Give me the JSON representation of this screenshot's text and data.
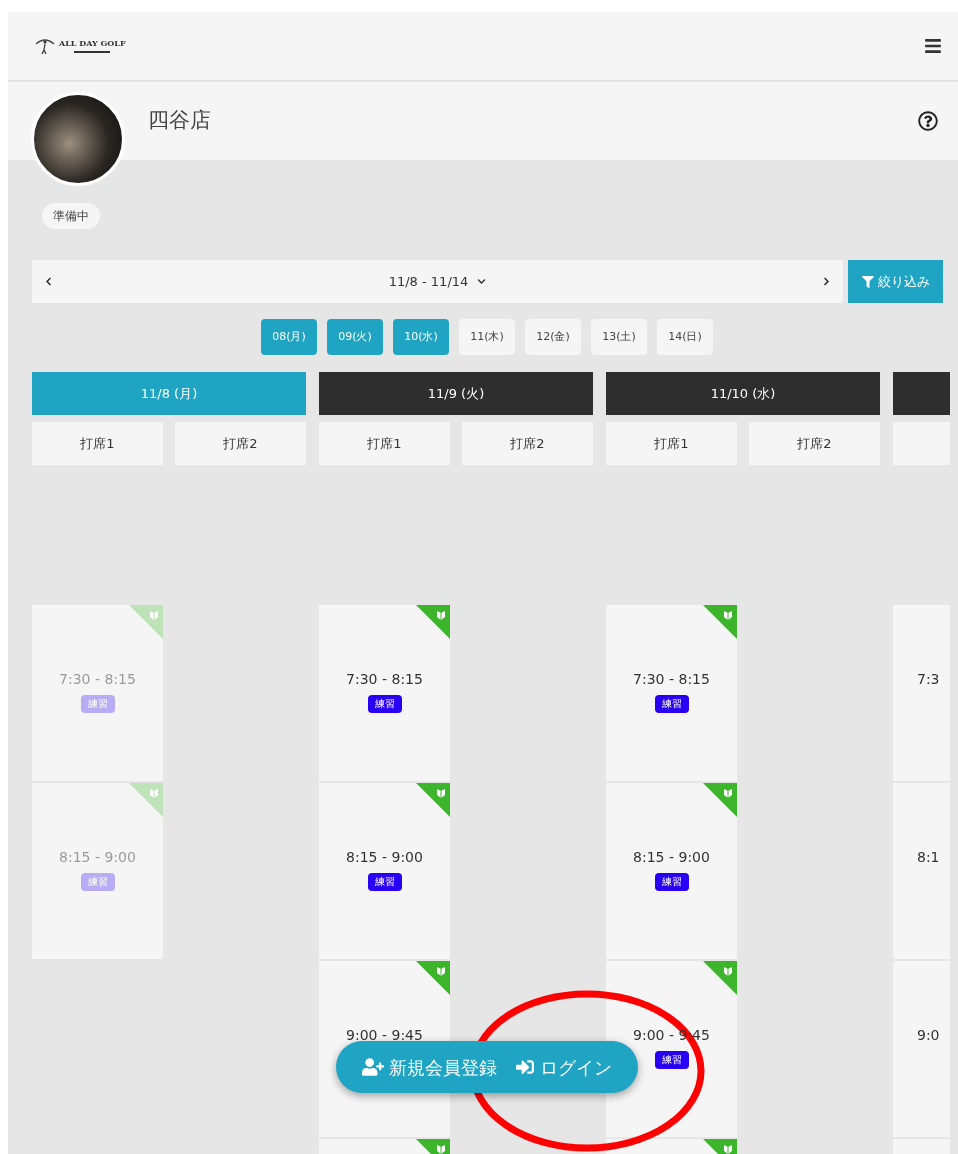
{
  "header": {
    "logo_text": "ALL DAY GOLF"
  },
  "store": {
    "name": "四谷店",
    "status": "準備中"
  },
  "date_nav": {
    "range": "11/8 - 11/14",
    "filter_label": "絞り込み"
  },
  "date_chips": [
    {
      "label": "08(月)",
      "selected": true
    },
    {
      "label": "09(火)",
      "selected": true
    },
    {
      "label": "10(水)",
      "selected": true
    },
    {
      "label": "11(木)",
      "selected": false
    },
    {
      "label": "12(金)",
      "selected": false
    },
    {
      "label": "13(土)",
      "selected": false
    },
    {
      "label": "14(日)",
      "selected": false
    }
  ],
  "days": [
    {
      "header": "11/8 (月)",
      "selected": true,
      "seats": [
        "打席1",
        "打席2"
      ],
      "slots": [
        {
          "kind": "slot",
          "time": "7:30 - 8:15",
          "tag": "練習",
          "disabled": true
        },
        {
          "kind": "slot",
          "time": "8:15 - 9:00",
          "tag": "練習",
          "disabled": true
        }
      ]
    },
    {
      "header": "11/9 (火)",
      "selected": false,
      "seats": [
        "打席1",
        "打席2"
      ],
      "slots": [
        {
          "kind": "slot",
          "time": "7:30 - 8:15",
          "tag": "練習",
          "disabled": false
        },
        {
          "kind": "slot",
          "time": "8:15 - 9:00",
          "tag": "練習",
          "disabled": false
        },
        {
          "kind": "slot",
          "time": "9:00 - 9:45",
          "disabled": false
        },
        {
          "kind": "partial",
          "disabled": false
        }
      ]
    },
    {
      "header": "11/10 (水)",
      "selected": false,
      "seats": [
        "打席1",
        "打席2"
      ],
      "slots": [
        {
          "kind": "slot",
          "time": "7:30 - 8:15",
          "tag": "練習",
          "disabled": false
        },
        {
          "kind": "slot",
          "time": "8:15 - 9:00",
          "tag": "練習",
          "disabled": false
        },
        {
          "kind": "slot",
          "time": "9:00 - 9:45",
          "tag": "練習",
          "disabled": false
        },
        {
          "kind": "partial",
          "disabled": false
        }
      ]
    },
    {
      "selected": false,
      "slots": [
        {
          "kind": "slot",
          "time": "7:3",
          "disabled": false
        },
        {
          "kind": "slot",
          "time": "8:1",
          "disabled": false
        },
        {
          "kind": "slot",
          "time": "9:0",
          "disabled": false
        },
        {
          "kind": "partial"
        }
      ]
    }
  ],
  "floating_actions": {
    "register": "新規会員登録",
    "login": "ログイン"
  }
}
